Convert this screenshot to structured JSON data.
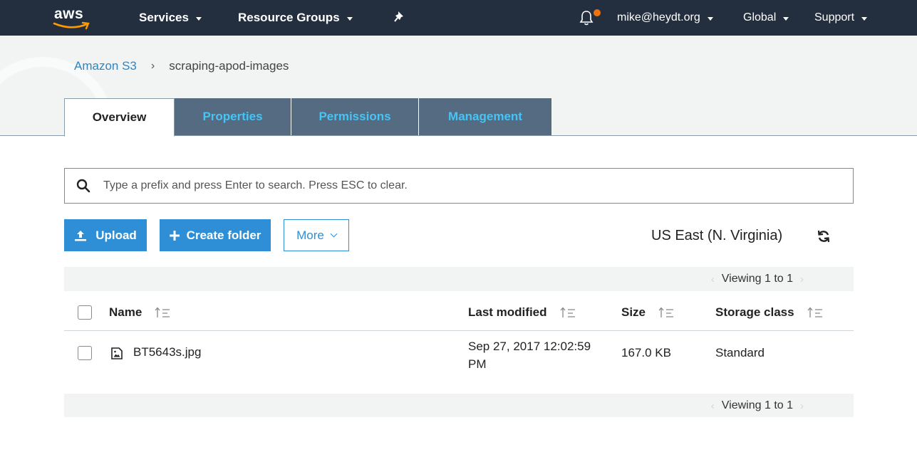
{
  "topnav": {
    "logo_text": "aws",
    "services_label": "Services",
    "resource_groups_label": "Resource Groups",
    "pin_icon": "pin-icon",
    "bell_icon": "bell-icon",
    "notification_color": "#ec7211",
    "account_label": "mike@heydt.org",
    "region_label": "Global",
    "support_label": "Support"
  },
  "breadcrumb": {
    "root_label": "Amazon S3",
    "separator": "›",
    "current_label": "scraping-apod-images"
  },
  "tabs": [
    {
      "label": "Overview",
      "active": true
    },
    {
      "label": "Properties",
      "active": false
    },
    {
      "label": "Permissions",
      "active": false
    },
    {
      "label": "Management",
      "active": false
    }
  ],
  "search": {
    "icon": "search-icon",
    "placeholder": "Type a prefix and press Enter to search. Press ESC to clear.",
    "value": ""
  },
  "actions": {
    "upload_label": "Upload",
    "upload_icon": "upload-icon",
    "create_folder_label": "Create folder",
    "create_folder_icon": "plus-icon",
    "more_label": "More",
    "accent_color": "#2e8fd6"
  },
  "region_display": "US East (N. Virginia)",
  "pagination": {
    "top_label": "Viewing 1 to 1",
    "bottom_label": "Viewing 1 to 1",
    "prev_glyph": "‹",
    "next_glyph": "›"
  },
  "table": {
    "columns": [
      {
        "label": "Name"
      },
      {
        "label": "Last modified"
      },
      {
        "label": "Size"
      },
      {
        "label": "Storage class"
      }
    ],
    "rows": [
      {
        "name": "BT5643s.jpg",
        "icon": "image-file-icon",
        "last_modified_line1": "Sep 27, 2017 12:02:59",
        "last_modified_line2": "PM",
        "size": "167.0 KB",
        "storage_class": "Standard"
      }
    ]
  }
}
